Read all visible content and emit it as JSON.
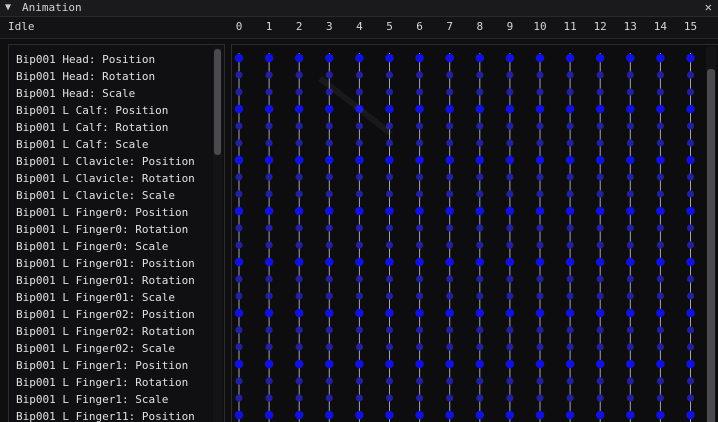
{
  "window": {
    "title": "Animation",
    "collapse_glyph": "▼",
    "close_glyph": "✕"
  },
  "clip": {
    "name": "Idle"
  },
  "frames": [
    "0",
    "1",
    "2",
    "3",
    "4",
    "5",
    "6",
    "7",
    "8",
    "9",
    "10",
    "11",
    "12",
    "13",
    "14",
    "15"
  ],
  "tracks": [
    "Bip001 Head: Position",
    "Bip001 Head: Rotation",
    "Bip001 Head: Scale",
    "Bip001 L Calf: Position",
    "Bip001 L Calf: Rotation",
    "Bip001 L Calf: Scale",
    "Bip001 L Clavicle: Position",
    "Bip001 L Clavicle: Rotation",
    "Bip001 L Clavicle: Scale",
    "Bip001 L Finger0: Position",
    "Bip001 L Finger0: Rotation",
    "Bip001 L Finger0: Scale",
    "Bip001 L Finger01: Position",
    "Bip001 L Finger01: Rotation",
    "Bip001 L Finger01: Scale",
    "Bip001 L Finger02: Position",
    "Bip001 L Finger02: Rotation",
    "Bip001 L Finger02: Scale",
    "Bip001 L Finger1: Position",
    "Bip001 L Finger1: Rotation",
    "Bip001 L Finger1: Scale",
    "Bip001 L Finger11: Position"
  ],
  "colors": {
    "keyframe": "#1010e0",
    "keyframe_dim": "#2020a0",
    "frame_line": "#d8d8e0"
  },
  "icons": {
    "collapse": "triangle-down-icon",
    "close": "close-icon"
  }
}
